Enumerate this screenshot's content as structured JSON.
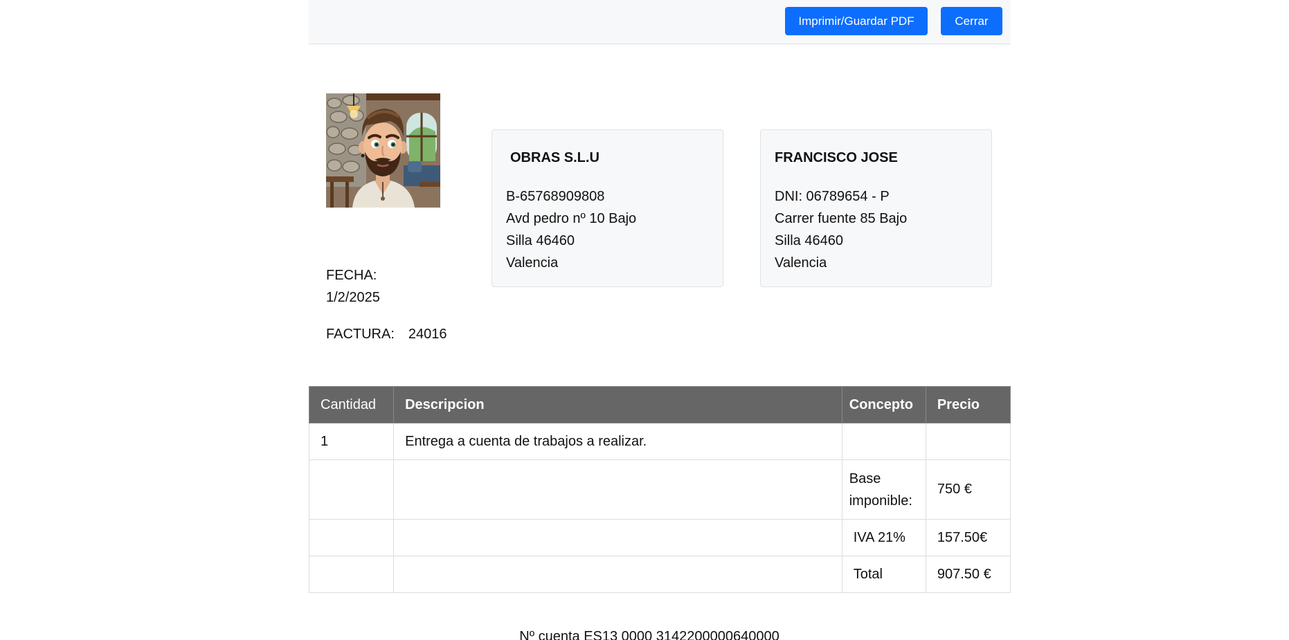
{
  "toolbar": {
    "print_label": "Imprimir/Guardar PDF",
    "close_label": "Cerrar"
  },
  "invoice": {
    "fecha_label": "FECHA:",
    "fecha_value": "1/2/2025",
    "factura_label": "FACTURA:",
    "factura_number": "24016"
  },
  "emitter": {
    "name": "OBRAS S.L.U",
    "lines": [
      "B-65768909808",
      "Avd pedro nº 10 Bajo",
      "Silla 46460",
      "Valencia"
    ]
  },
  "client": {
    "name": "FRANCISCO JOSE",
    "lines": [
      "DNI: 06789654 - P",
      "Carrer fuente 85 Bajo",
      "Silla 46460",
      "Valencia"
    ]
  },
  "table": {
    "headers": [
      "Cantidad",
      "Descripcion",
      "Concepto",
      "Precio"
    ],
    "rows": [
      {
        "cantidad": "1",
        "descripcion": "Entrega a cuenta de trabajos a realizar.",
        "concepto": "",
        "precio": ""
      }
    ],
    "summary": [
      {
        "label": "Base imponible:",
        "value": "750 €"
      },
      {
        "label": "IVA 21%",
        "value": "157.50€"
      },
      {
        "label": "Total",
        "value": "907.50 €"
      }
    ]
  },
  "footer": {
    "account": "Nº cuenta ES13 0000 3142200000640000"
  },
  "colors": {
    "primary_button": "#0d6efd",
    "table_header": "#666666",
    "card_background": "#f7f8fa"
  },
  "icons": {
    "avatar": "cartoon-bearded-man-avatar"
  }
}
